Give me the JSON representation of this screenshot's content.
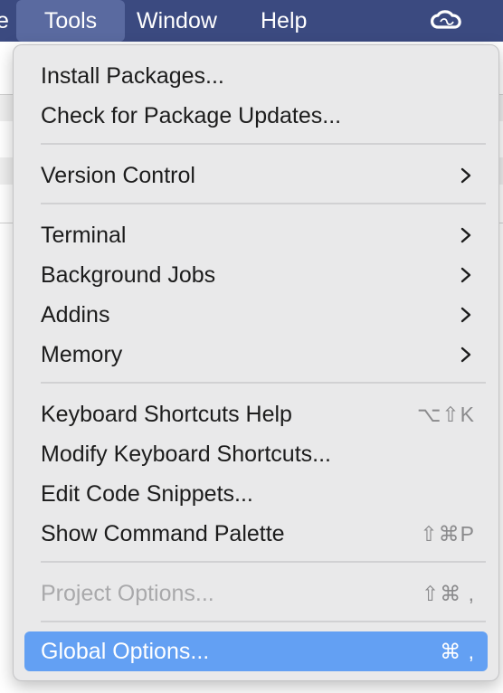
{
  "menubar": {
    "partial_item": "e",
    "tools": "Tools",
    "window": "Window",
    "help": "Help",
    "right_icon": "creative-cloud-icon"
  },
  "menu": {
    "install_packages": "Install Packages...",
    "check_updates": "Check for Package Updates...",
    "version_control": "Version Control",
    "terminal": "Terminal",
    "background_jobs": "Background Jobs",
    "addins": "Addins",
    "memory": "Memory",
    "keyboard_help": "Keyboard Shortcuts Help",
    "keyboard_help_shortcut": "⌥⇧K",
    "modify_shortcuts": "Modify Keyboard Shortcuts...",
    "edit_snippets": "Edit Code Snippets...",
    "command_palette": "Show Command Palette",
    "command_palette_shortcut": "⇧⌘P",
    "project_options": "Project Options...",
    "project_options_shortcut": "⇧⌘ ,",
    "global_options": "Global Options...",
    "global_options_shortcut": "⌘ ,"
  },
  "colors": {
    "menubar": "#3b4a80",
    "highlight": "#63a0f3",
    "menu_bg": "#e9e9ea"
  }
}
